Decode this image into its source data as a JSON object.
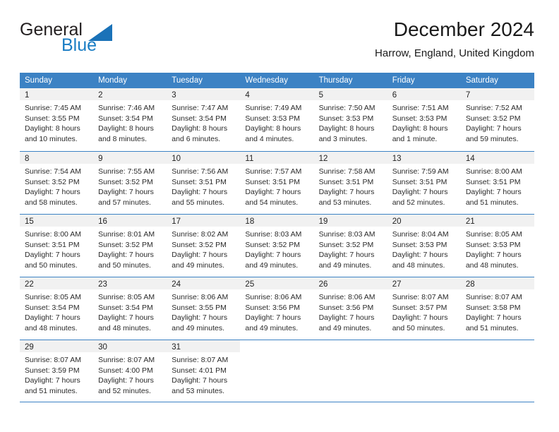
{
  "brand": {
    "name_part1": "General",
    "name_part2": "Blue",
    "triangle_color": "#1a72b8",
    "blue_color": "#1a7dc4"
  },
  "header": {
    "title": "December 2024",
    "location": "Harrow, England, United Kingdom"
  },
  "calendar": {
    "header_bg": "#3c82c4",
    "day_band_bg": "#f1f1f1",
    "weekdays": [
      "Sunday",
      "Monday",
      "Tuesday",
      "Wednesday",
      "Thursday",
      "Friday",
      "Saturday"
    ],
    "weeks": [
      [
        {
          "day": "1",
          "sunrise": "Sunrise: 7:45 AM",
          "sunset": "Sunset: 3:55 PM",
          "daylight1": "Daylight: 8 hours",
          "daylight2": "and 10 minutes."
        },
        {
          "day": "2",
          "sunrise": "Sunrise: 7:46 AM",
          "sunset": "Sunset: 3:54 PM",
          "daylight1": "Daylight: 8 hours",
          "daylight2": "and 8 minutes."
        },
        {
          "day": "3",
          "sunrise": "Sunrise: 7:47 AM",
          "sunset": "Sunset: 3:54 PM",
          "daylight1": "Daylight: 8 hours",
          "daylight2": "and 6 minutes."
        },
        {
          "day": "4",
          "sunrise": "Sunrise: 7:49 AM",
          "sunset": "Sunset: 3:53 PM",
          "daylight1": "Daylight: 8 hours",
          "daylight2": "and 4 minutes."
        },
        {
          "day": "5",
          "sunrise": "Sunrise: 7:50 AM",
          "sunset": "Sunset: 3:53 PM",
          "daylight1": "Daylight: 8 hours",
          "daylight2": "and 3 minutes."
        },
        {
          "day": "6",
          "sunrise": "Sunrise: 7:51 AM",
          "sunset": "Sunset: 3:53 PM",
          "daylight1": "Daylight: 8 hours",
          "daylight2": "and 1 minute."
        },
        {
          "day": "7",
          "sunrise": "Sunrise: 7:52 AM",
          "sunset": "Sunset: 3:52 PM",
          "daylight1": "Daylight: 7 hours",
          "daylight2": "and 59 minutes."
        }
      ],
      [
        {
          "day": "8",
          "sunrise": "Sunrise: 7:54 AM",
          "sunset": "Sunset: 3:52 PM",
          "daylight1": "Daylight: 7 hours",
          "daylight2": "and 58 minutes."
        },
        {
          "day": "9",
          "sunrise": "Sunrise: 7:55 AM",
          "sunset": "Sunset: 3:52 PM",
          "daylight1": "Daylight: 7 hours",
          "daylight2": "and 57 minutes."
        },
        {
          "day": "10",
          "sunrise": "Sunrise: 7:56 AM",
          "sunset": "Sunset: 3:51 PM",
          "daylight1": "Daylight: 7 hours",
          "daylight2": "and 55 minutes."
        },
        {
          "day": "11",
          "sunrise": "Sunrise: 7:57 AM",
          "sunset": "Sunset: 3:51 PM",
          "daylight1": "Daylight: 7 hours",
          "daylight2": "and 54 minutes."
        },
        {
          "day": "12",
          "sunrise": "Sunrise: 7:58 AM",
          "sunset": "Sunset: 3:51 PM",
          "daylight1": "Daylight: 7 hours",
          "daylight2": "and 53 minutes."
        },
        {
          "day": "13",
          "sunrise": "Sunrise: 7:59 AM",
          "sunset": "Sunset: 3:51 PM",
          "daylight1": "Daylight: 7 hours",
          "daylight2": "and 52 minutes."
        },
        {
          "day": "14",
          "sunrise": "Sunrise: 8:00 AM",
          "sunset": "Sunset: 3:51 PM",
          "daylight1": "Daylight: 7 hours",
          "daylight2": "and 51 minutes."
        }
      ],
      [
        {
          "day": "15",
          "sunrise": "Sunrise: 8:00 AM",
          "sunset": "Sunset: 3:51 PM",
          "daylight1": "Daylight: 7 hours",
          "daylight2": "and 50 minutes."
        },
        {
          "day": "16",
          "sunrise": "Sunrise: 8:01 AM",
          "sunset": "Sunset: 3:52 PM",
          "daylight1": "Daylight: 7 hours",
          "daylight2": "and 50 minutes."
        },
        {
          "day": "17",
          "sunrise": "Sunrise: 8:02 AM",
          "sunset": "Sunset: 3:52 PM",
          "daylight1": "Daylight: 7 hours",
          "daylight2": "and 49 minutes."
        },
        {
          "day": "18",
          "sunrise": "Sunrise: 8:03 AM",
          "sunset": "Sunset: 3:52 PM",
          "daylight1": "Daylight: 7 hours",
          "daylight2": "and 49 minutes."
        },
        {
          "day": "19",
          "sunrise": "Sunrise: 8:03 AM",
          "sunset": "Sunset: 3:52 PM",
          "daylight1": "Daylight: 7 hours",
          "daylight2": "and 49 minutes."
        },
        {
          "day": "20",
          "sunrise": "Sunrise: 8:04 AM",
          "sunset": "Sunset: 3:53 PM",
          "daylight1": "Daylight: 7 hours",
          "daylight2": "and 48 minutes."
        },
        {
          "day": "21",
          "sunrise": "Sunrise: 8:05 AM",
          "sunset": "Sunset: 3:53 PM",
          "daylight1": "Daylight: 7 hours",
          "daylight2": "and 48 minutes."
        }
      ],
      [
        {
          "day": "22",
          "sunrise": "Sunrise: 8:05 AM",
          "sunset": "Sunset: 3:54 PM",
          "daylight1": "Daylight: 7 hours",
          "daylight2": "and 48 minutes."
        },
        {
          "day": "23",
          "sunrise": "Sunrise: 8:05 AM",
          "sunset": "Sunset: 3:54 PM",
          "daylight1": "Daylight: 7 hours",
          "daylight2": "and 48 minutes."
        },
        {
          "day": "24",
          "sunrise": "Sunrise: 8:06 AM",
          "sunset": "Sunset: 3:55 PM",
          "daylight1": "Daylight: 7 hours",
          "daylight2": "and 49 minutes."
        },
        {
          "day": "25",
          "sunrise": "Sunrise: 8:06 AM",
          "sunset": "Sunset: 3:56 PM",
          "daylight1": "Daylight: 7 hours",
          "daylight2": "and 49 minutes."
        },
        {
          "day": "26",
          "sunrise": "Sunrise: 8:06 AM",
          "sunset": "Sunset: 3:56 PM",
          "daylight1": "Daylight: 7 hours",
          "daylight2": "and 49 minutes."
        },
        {
          "day": "27",
          "sunrise": "Sunrise: 8:07 AM",
          "sunset": "Sunset: 3:57 PM",
          "daylight1": "Daylight: 7 hours",
          "daylight2": "and 50 minutes."
        },
        {
          "day": "28",
          "sunrise": "Sunrise: 8:07 AM",
          "sunset": "Sunset: 3:58 PM",
          "daylight1": "Daylight: 7 hours",
          "daylight2": "and 51 minutes."
        }
      ],
      [
        {
          "day": "29",
          "sunrise": "Sunrise: 8:07 AM",
          "sunset": "Sunset: 3:59 PM",
          "daylight1": "Daylight: 7 hours",
          "daylight2": "and 51 minutes."
        },
        {
          "day": "30",
          "sunrise": "Sunrise: 8:07 AM",
          "sunset": "Sunset: 4:00 PM",
          "daylight1": "Daylight: 7 hours",
          "daylight2": "and 52 minutes."
        },
        {
          "day": "31",
          "sunrise": "Sunrise: 8:07 AM",
          "sunset": "Sunset: 4:01 PM",
          "daylight1": "Daylight: 7 hours",
          "daylight2": "and 53 minutes."
        },
        {
          "day": "",
          "sunrise": "",
          "sunset": "",
          "daylight1": "",
          "daylight2": ""
        },
        {
          "day": "",
          "sunrise": "",
          "sunset": "",
          "daylight1": "",
          "daylight2": ""
        },
        {
          "day": "",
          "sunrise": "",
          "sunset": "",
          "daylight1": "",
          "daylight2": ""
        },
        {
          "day": "",
          "sunrise": "",
          "sunset": "",
          "daylight1": "",
          "daylight2": ""
        }
      ]
    ]
  }
}
